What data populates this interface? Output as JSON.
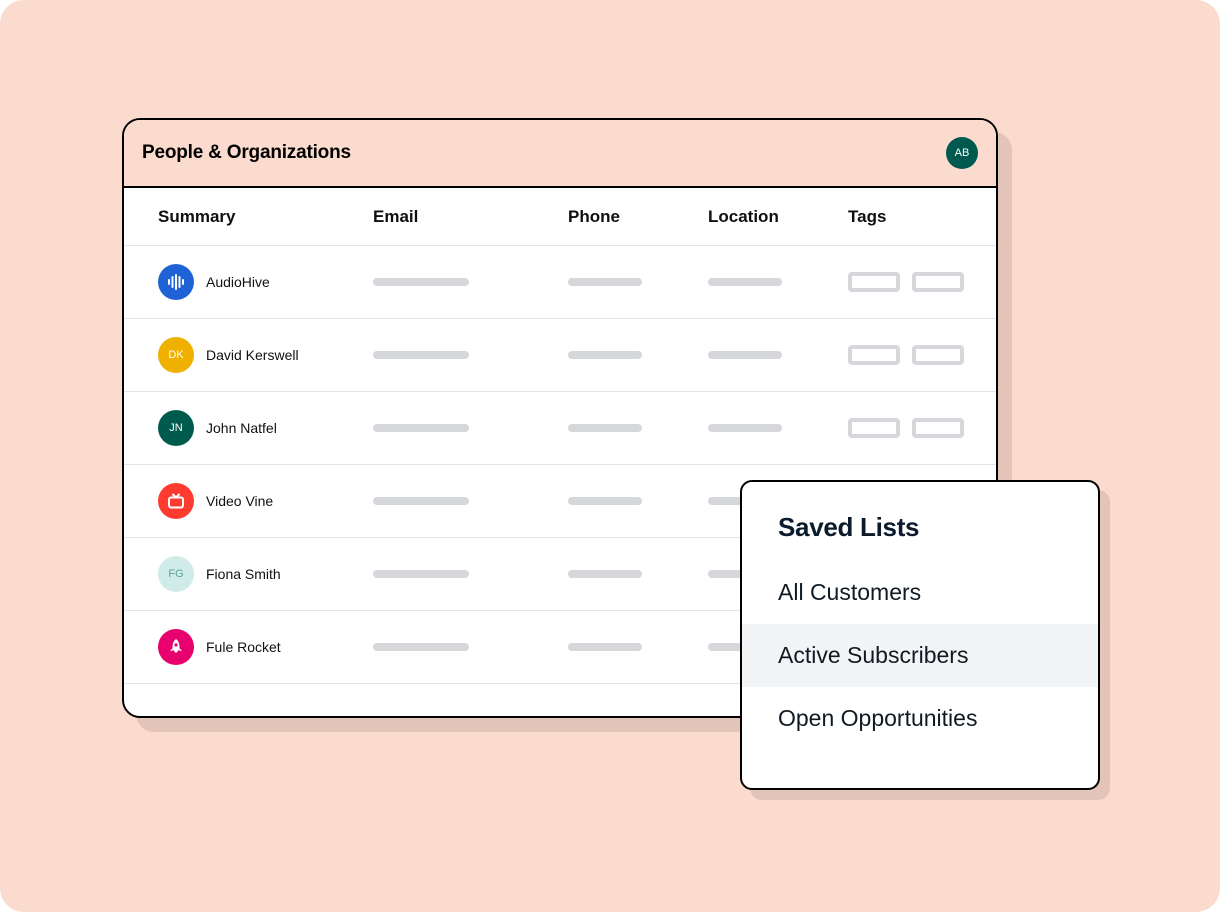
{
  "header": {
    "title": "People & Organizations",
    "avatar_initials": "AB"
  },
  "columns": {
    "summary": "Summary",
    "email": "Email",
    "phone": "Phone",
    "location": "Location",
    "tags": "Tags"
  },
  "rows": [
    {
      "name": "AudioHive",
      "badge": {
        "type": "icon",
        "icon": "waveform",
        "bg": "#1F62D5",
        "fg": "#ffffff"
      },
      "show_tags": true
    },
    {
      "name": "David Kerswell",
      "badge": {
        "type": "text",
        "text": "DK",
        "bg": "#F0B000",
        "fg": "#ffffff"
      },
      "show_tags": true
    },
    {
      "name": "John Natfel",
      "badge": {
        "type": "text",
        "text": "JN",
        "bg": "#005B4F",
        "fg": "#ffffff"
      },
      "show_tags": true
    },
    {
      "name": "Video Vine",
      "badge": {
        "type": "icon",
        "icon": "tv",
        "bg": "#FF3A2F",
        "fg": "#ffffff"
      },
      "show_tags": false
    },
    {
      "name": "Fiona Smith",
      "badge": {
        "type": "text",
        "text": "FG",
        "bg": "#CFECE8",
        "fg": "#5AA59B"
      },
      "show_tags": false
    },
    {
      "name": "Fule Rocket",
      "badge": {
        "type": "icon",
        "icon": "rocket",
        "bg": "#E8006F",
        "fg": "#ffffff"
      },
      "show_tags": false
    }
  ],
  "popover": {
    "title": "Saved Lists",
    "items": [
      {
        "label": "All Customers",
        "active": false
      },
      {
        "label": "Active Subscribers",
        "active": true
      },
      {
        "label": "Open Opportunities",
        "active": false
      }
    ]
  }
}
